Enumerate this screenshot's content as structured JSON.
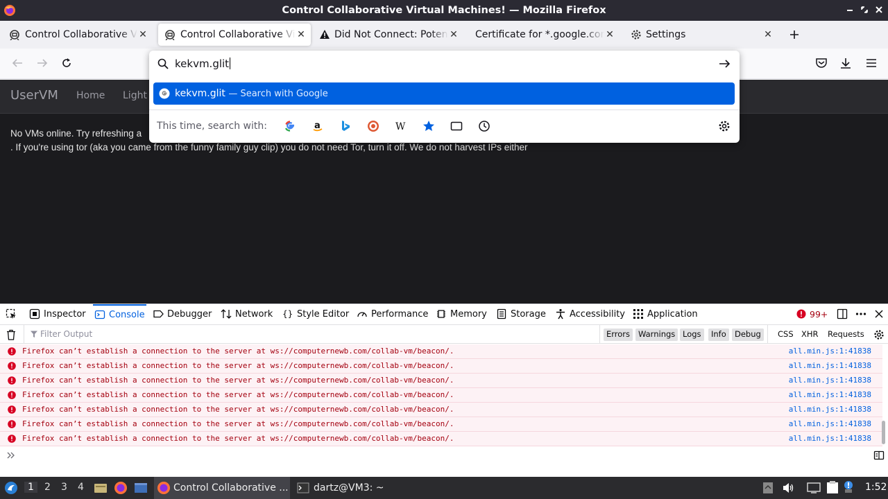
{
  "window": {
    "title": "Control Collaborative Virtual Machines! — Mozilla Firefox"
  },
  "tabs": [
    {
      "label": "Control Collaborative Virtual Machines!",
      "icon": "collabvm-icon",
      "active": false
    },
    {
      "label": "Control Collaborative Virtual Machines!",
      "icon": "collabvm-icon",
      "active": true
    },
    {
      "label": "Did Not Connect: Potential Security Issue",
      "icon": "warning-icon",
      "active": false
    },
    {
      "label": "Certificate for *.google.com",
      "icon": "none",
      "active": false
    },
    {
      "label": "Settings",
      "icon": "gear-icon",
      "active": false
    }
  ],
  "urlbar": {
    "value": "kekvm.glit",
    "suggestion": {
      "text": "kekvm.glit",
      "action": "— Search with Google"
    },
    "one_off_label": "This time, search with:",
    "engines": [
      "google-icon",
      "amazon-icon",
      "bing-icon",
      "duckduckgo-icon",
      "wikipedia-icon",
      "bookmarks-icon",
      "tabs-icon",
      "history-icon"
    ]
  },
  "page": {
    "brand": "UserVM",
    "nav": [
      "Home",
      "Light T"
    ],
    "message_line1": "No VMs online. Try refreshing a",
    "message_line2": ". If you're using tor (aka you came from the funny family guy clip) you do not need Tor, turn it off. We do not harvest IPs either"
  },
  "devtools": {
    "tabs": [
      "Inspector",
      "Console",
      "Debugger",
      "Network",
      "Style Editor",
      "Performance",
      "Memory",
      "Storage",
      "Accessibility",
      "Application"
    ],
    "active_tab": "Console",
    "error_count": "99+",
    "filter_placeholder": "Filter Output",
    "filters": [
      "Errors",
      "Warnings",
      "Logs",
      "Info",
      "Debug"
    ],
    "net_filters": [
      "CSS",
      "XHR",
      "Requests"
    ],
    "log_message": "Firefox can’t establish a connection to the server at ws://computernewb.com/collab-vm/beacon/.",
    "log_source": "all.min.js:1:41838",
    "log_count": 7
  },
  "taskbar": {
    "workspaces": [
      "1",
      "2",
      "3",
      "4"
    ],
    "tasks": [
      {
        "label": "Control Collaborative ...",
        "icon": "firefox-icon",
        "active": true
      },
      {
        "label": "dartz@VM3: ~",
        "icon": "terminal-icon",
        "active": false
      }
    ],
    "clock": "1:52"
  },
  "colors": {
    "accent": "#0061e0",
    "devtools_accent": "#0060df",
    "error": "#a4000f",
    "page_bg": "#1b1b1e",
    "taskbar": "#2b2b2e"
  }
}
